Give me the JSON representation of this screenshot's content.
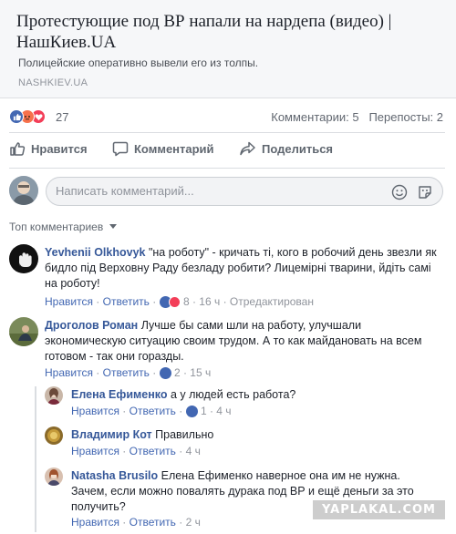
{
  "link_preview": {
    "title": "Протестующие под ВР напали на нардепа (видео) | НашКиев.UA",
    "description": "Полицейские оперативно вывели его из толпы.",
    "domain": "NASHKIEV.UA"
  },
  "reactions": {
    "count": "27",
    "comments_label": "Комментарии: 5",
    "shares_label": "Перепосты: 2",
    "icons": [
      "like-icon",
      "angry-icon",
      "love-icon"
    ],
    "colors": {
      "like": "#4267b2",
      "angry": "#f7714c",
      "love": "#f33e58"
    }
  },
  "actions": {
    "like": "Нравится",
    "comment": "Комментарий",
    "share": "Поделиться"
  },
  "comment_input": {
    "placeholder": "Написать комментарий..."
  },
  "sort": {
    "label": "Топ комментариев"
  },
  "comments": [
    {
      "author": "Yevhenii Olkhovyk",
      "text": "\"на роботу\" - кричать ті, кого в робочий день звезли як бидло під Верховну Раду безладу робити? Лицемірні тварини, йдіть самі на роботу!",
      "like": "Нравится",
      "reply": "Ответить",
      "reactions": "8",
      "time": "16 ч",
      "edited": "Отредактирован"
    },
    {
      "author": "Дроголов Роман",
      "text": "Лучше бы сами шли на работу, улучшали экономическую ситуацию своим трудом. А то как майдановать на всем готовом - так они горазды.",
      "like": "Нравится",
      "reply": "Ответить",
      "reactions": "2",
      "time": "15 ч"
    }
  ],
  "replies": [
    {
      "author": "Елена Ефименко",
      "text": "а у людей есть работа?",
      "like": "Нравится",
      "reply": "Ответить",
      "reactions": "1",
      "time": "4 ч"
    },
    {
      "author": "Владимир Кот",
      "text": "Правильно",
      "like": "Нравится",
      "reply": "Ответить",
      "time": "4 ч"
    },
    {
      "author": "Natasha Brusilo",
      "text": "Елена Ефименко наверное она им не нужна. Зачем, если можно повалять дурака под ВР и ещё деньги за это получить?",
      "like": "Нравится",
      "reply": "Ответить",
      "time": "2 ч"
    }
  ],
  "watermark": "YAPLAKAL.COM"
}
